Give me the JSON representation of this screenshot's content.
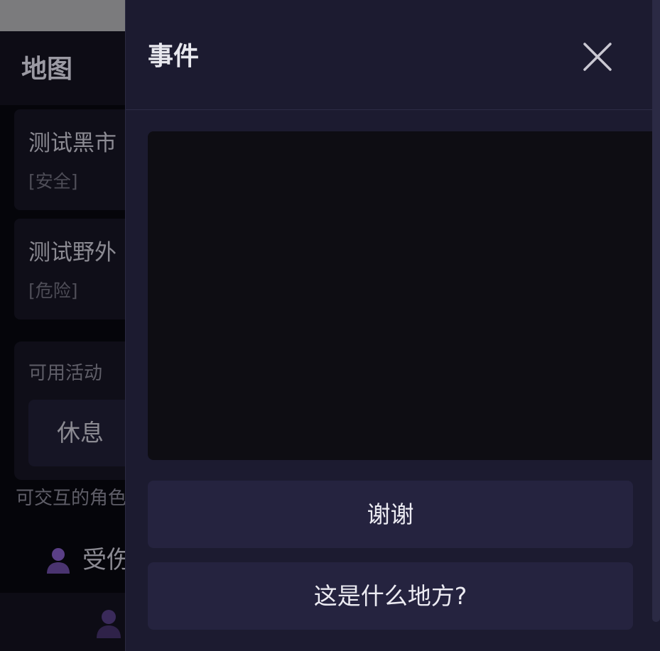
{
  "page": {
    "title": "地图",
    "locations": [
      {
        "name": "测试黑市",
        "status": "[安全]"
      },
      {
        "name": "测试野外",
        "status": "[危险]"
      }
    ],
    "activities": {
      "label": "可用活动",
      "items": [
        "休息"
      ]
    },
    "npcs": {
      "heading": "可交互的角色",
      "items": [
        {
          "name": "受伤"
        }
      ]
    }
  },
  "dialog": {
    "title": "事件",
    "content": "",
    "choices": [
      "谢谢",
      "这是什么地方?"
    ]
  },
  "colors": {
    "dialog_bg": "#1c1b30",
    "choice_bg": "#25233f",
    "content_bg": "#0e0d13",
    "page_bg": "#05050a",
    "npc_icon": "#5a3f86"
  },
  "icons": {
    "close": "close-icon",
    "npc": "person-icon",
    "nav": "person-icon"
  }
}
